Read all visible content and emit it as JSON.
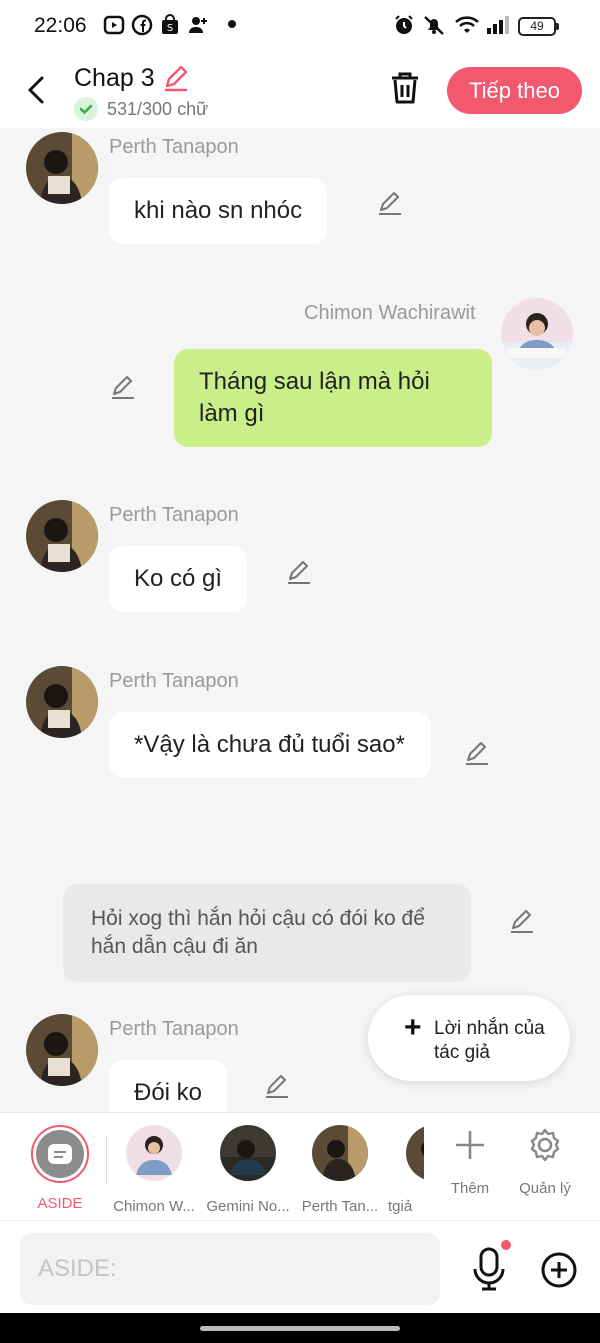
{
  "status_bar": {
    "time": "22:06",
    "battery": "49"
  },
  "header": {
    "title": "Chap 3",
    "word_count": "531/300 chữ",
    "next_label": "Tiếp theo"
  },
  "messages": [
    {
      "sender": "Perth Tanapon",
      "text": "khi nào sn nhóc"
    },
    {
      "sender": "Chimon Wachirawit",
      "text": "Tháng sau lận mà hỏi làm gì"
    },
    {
      "sender": "Perth Tanapon",
      "text": "Ko có gì"
    },
    {
      "sender": "Perth Tanapon",
      "text": "*Vậy là chưa đủ tuổi sao*"
    },
    {
      "aside": "Hỏi xog thì hắn hỏi cậu có đói ko để hắn dẫn cậu đi ăn"
    },
    {
      "sender": "Perth Tanapon",
      "text": "Đói ko"
    }
  ],
  "author_note_button": "Lời nhắn của tác giả",
  "characters": [
    {
      "name": "ASIDE"
    },
    {
      "name": "Chimon W..."
    },
    {
      "name": "Gemini No..."
    },
    {
      "name": "Perth Tan..."
    },
    {
      "name": "tgiả"
    }
  ],
  "tools": {
    "more_label": "Thêm",
    "manage_label": "Quản lý"
  },
  "input": {
    "placeholder": "ASIDE:"
  },
  "colors": {
    "accent": "#f2596f",
    "my_bubble": "#c9ee8a",
    "background": "#f5f5f5"
  }
}
